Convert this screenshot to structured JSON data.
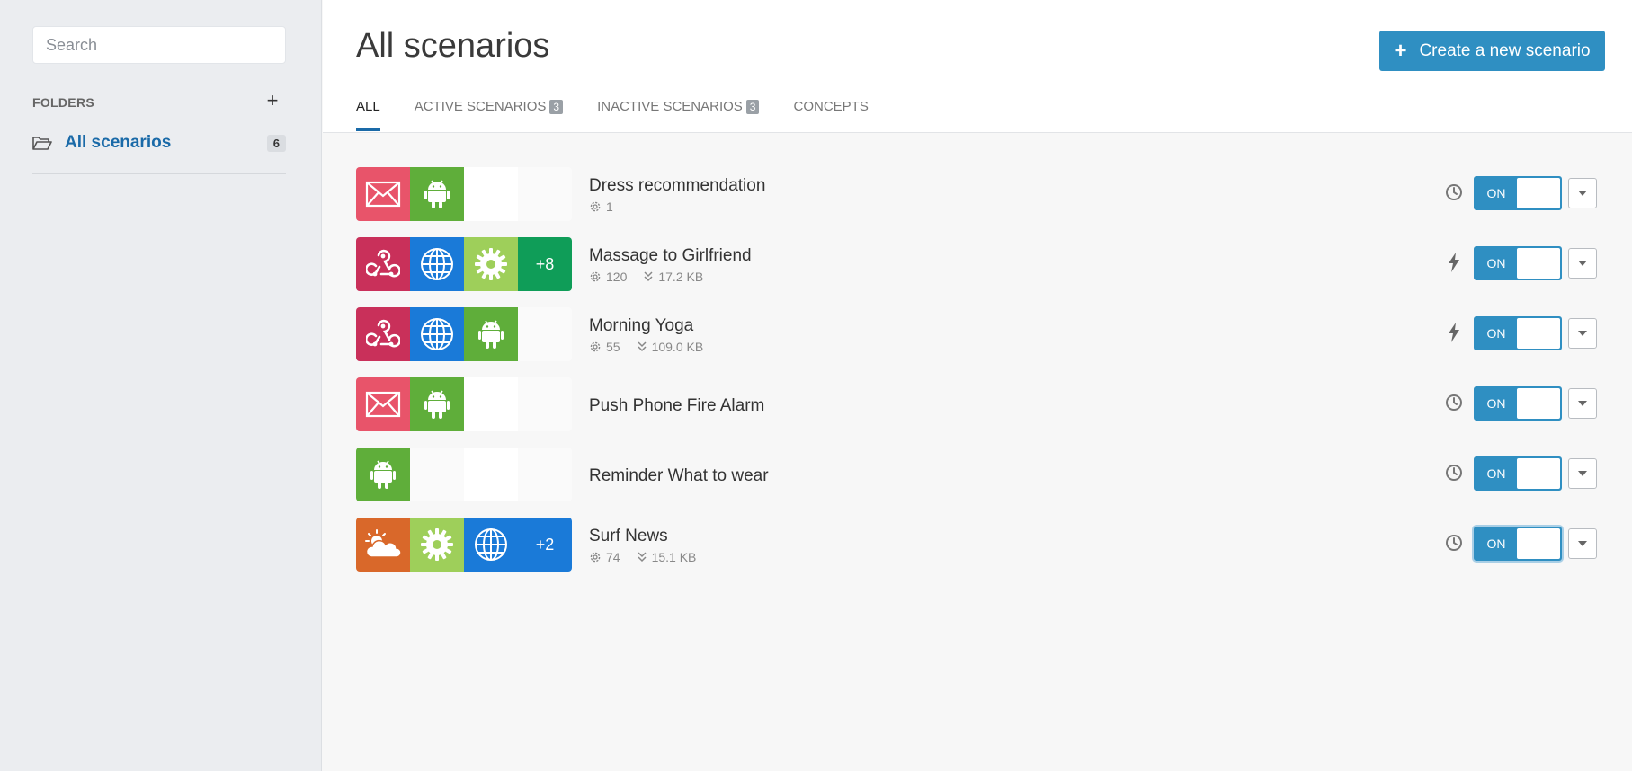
{
  "sidebar": {
    "search_placeholder": "Search",
    "folders_label": "FOLDERS",
    "folders_add": "+",
    "folder": {
      "name": "All scenarios",
      "count": "6"
    }
  },
  "header": {
    "title": "All scenarios",
    "create_button": "Create a new scenario",
    "create_icon": "+",
    "tabs": [
      {
        "label": "ALL",
        "badge": null
      },
      {
        "label": "ACTIVE SCENARIOS",
        "badge": "3"
      },
      {
        "label": "INACTIVE SCENARIOS",
        "badge": "3"
      },
      {
        "label": "CONCEPTS",
        "badge": null
      }
    ]
  },
  "colors": {
    "accent": "#2f8fc2",
    "email": "#e8546a",
    "android": "#5fae3a",
    "webhook": "#c9305a",
    "globe": "#1a7ad8",
    "gear": "#9ecf5a",
    "more_green": "#0f9d58",
    "weather": "#d9682a",
    "more_blue": "#1a7ad8"
  },
  "scenarios": [
    {
      "name": "Dress recommendation",
      "ops": "1",
      "data": null,
      "trigger": "clock-icon",
      "toggle": "ON",
      "tiles": [
        "email-icon",
        "android-icon"
      ],
      "more": null
    },
    {
      "name": "Massage to Girlfriend",
      "ops": "120",
      "data": "17.2 KB",
      "trigger": "lightning-icon",
      "toggle": "ON",
      "tiles": [
        "webhook-icon",
        "globe-icon",
        "gear-icon"
      ],
      "more": "+8"
    },
    {
      "name": "Morning Yoga",
      "ops": "55",
      "data": "109.0 KB",
      "trigger": "lightning-icon",
      "toggle": "ON",
      "tiles": [
        "webhook-icon",
        "globe-icon",
        "android-icon"
      ],
      "more": null
    },
    {
      "name": "Push Phone Fire Alarm",
      "ops": null,
      "data": null,
      "trigger": "clock-icon",
      "toggle": "ON",
      "tiles": [
        "email-icon",
        "android-icon"
      ],
      "more": null
    },
    {
      "name": "Reminder What to wear",
      "ops": null,
      "data": null,
      "trigger": "clock-icon",
      "toggle": "ON",
      "tiles": [
        "android-icon"
      ],
      "more": null
    },
    {
      "name": "Surf News",
      "ops": "74",
      "data": "15.1 KB",
      "trigger": "clock-icon",
      "toggle": "ON",
      "tiles": [
        "weather-icon",
        "gear-icon",
        "globe-icon"
      ],
      "more": "+2"
    }
  ]
}
